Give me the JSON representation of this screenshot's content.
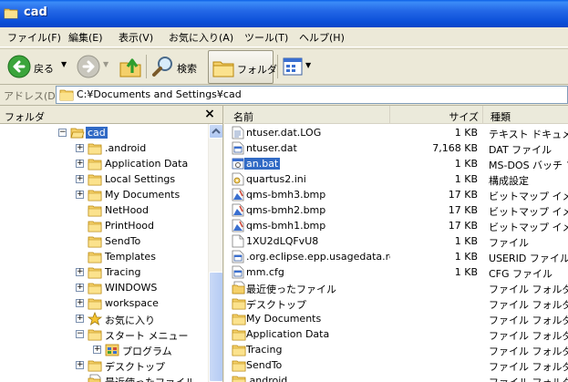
{
  "window": {
    "title": "cad"
  },
  "menu": [
    "ファイル(F)",
    "編集(E)",
    "表示(V)",
    "お気に入り(A)",
    "ツール(T)",
    "ヘルプ(H)"
  ],
  "toolbar": {
    "back_label": "戻る",
    "search_label": "検索",
    "folders_label": "フォルダ"
  },
  "address": {
    "label": "アドレス(D)",
    "value": "C:¥Documents and Settings¥cad"
  },
  "folder_pane": {
    "title": "フォルダ",
    "close": "×",
    "tree": [
      {
        "label": "cad",
        "icon": "folder-open-icon",
        "exp": "−",
        "selected": true,
        "level": 0
      },
      {
        "label": ".android",
        "icon": "folder-icon",
        "exp": "+",
        "level": 1
      },
      {
        "label": "Application Data",
        "icon": "folder-icon",
        "exp": "+",
        "level": 1
      },
      {
        "label": "Local Settings",
        "icon": "folder-icon",
        "exp": "+",
        "level": 1
      },
      {
        "label": "My Documents",
        "icon": "folder-icon",
        "exp": "+",
        "level": 1
      },
      {
        "label": "NetHood",
        "icon": "folder-icon",
        "exp": "",
        "level": 1
      },
      {
        "label": "PrintHood",
        "icon": "folder-icon",
        "exp": "",
        "level": 1
      },
      {
        "label": "SendTo",
        "icon": "folder-icon",
        "exp": "",
        "level": 1
      },
      {
        "label": "Templates",
        "icon": "folder-icon",
        "exp": "",
        "level": 1
      },
      {
        "label": "Tracing",
        "icon": "folder-icon",
        "exp": "+",
        "level": 1
      },
      {
        "label": "WINDOWS",
        "icon": "folder-icon",
        "exp": "+",
        "level": 1
      },
      {
        "label": "workspace",
        "icon": "folder-icon",
        "exp": "+",
        "level": 1
      },
      {
        "label": "お気に入り",
        "icon": "star-icon",
        "exp": "+",
        "level": 1
      },
      {
        "label": "スタート メニュー",
        "icon": "folder-icon",
        "exp": "−",
        "level": 1
      },
      {
        "label": "プログラム",
        "icon": "programs-icon",
        "exp": "+",
        "level": 2
      },
      {
        "label": "デスクトップ",
        "icon": "folder-icon",
        "exp": "+",
        "level": 1
      },
      {
        "label": "最近使ったファイル",
        "icon": "recent-icon",
        "exp": "",
        "level": 1
      }
    ]
  },
  "file_list": {
    "columns": {
      "name": "名前",
      "size": "サイズ",
      "type": "種類"
    },
    "rows": [
      {
        "name": "ntuser.dat.LOG",
        "size": "1 KB",
        "type": "テキスト ドキュメント",
        "icon": "text-file-icon"
      },
      {
        "name": "ntuser.dat",
        "size": "7,168 KB",
        "type": "DAT ファイル",
        "icon": "dat-file-icon"
      },
      {
        "name": "an.bat",
        "size": "1 KB",
        "type": "MS-DOS バッチ ファイル",
        "icon": "batch-file-icon",
        "selected": true
      },
      {
        "name": "quartus2.ini",
        "size": "1 KB",
        "type": "構成設定",
        "icon": "ini-file-icon"
      },
      {
        "name": "qms-bmh3.bmp",
        "size": "17 KB",
        "type": "ビットマップ イメージ",
        "icon": "bitmap-icon"
      },
      {
        "name": "qms-bmh2.bmp",
        "size": "17 KB",
        "type": "ビットマップ イメージ",
        "icon": "bitmap-icon"
      },
      {
        "name": "qms-bmh1.bmp",
        "size": "17 KB",
        "type": "ビットマップ イメージ",
        "icon": "bitmap-icon"
      },
      {
        "name": "1XU2dLQFvU8",
        "size": "1 KB",
        "type": "ファイル",
        "icon": "generic-file-icon"
      },
      {
        "name": ".org.eclipse.epp.usagedata.rec...",
        "size": "1 KB",
        "type": "USERID ファイル",
        "icon": "dat-file-icon"
      },
      {
        "name": "mm.cfg",
        "size": "1 KB",
        "type": "CFG ファイル",
        "icon": "dat-file-icon"
      },
      {
        "name": "最近使ったファイル",
        "size": "",
        "type": "ファイル フォルダ",
        "icon": "recent-icon"
      },
      {
        "name": "デスクトップ",
        "size": "",
        "type": "ファイル フォルダ",
        "icon": "folder-icon"
      },
      {
        "name": "My Documents",
        "size": "",
        "type": "ファイル フォルダ",
        "icon": "folder-icon"
      },
      {
        "name": "Application Data",
        "size": "",
        "type": "ファイル フォルダ",
        "icon": "folder-icon"
      },
      {
        "name": "Tracing",
        "size": "",
        "type": "ファイル フォルダ",
        "icon": "folder-icon"
      },
      {
        "name": "SendTo",
        "size": "",
        "type": "ファイル フォルダ",
        "icon": "folder-icon"
      },
      {
        "name": ".android",
        "size": "",
        "type": "ファイル フォルダ",
        "icon": "folder-icon"
      }
    ]
  }
}
